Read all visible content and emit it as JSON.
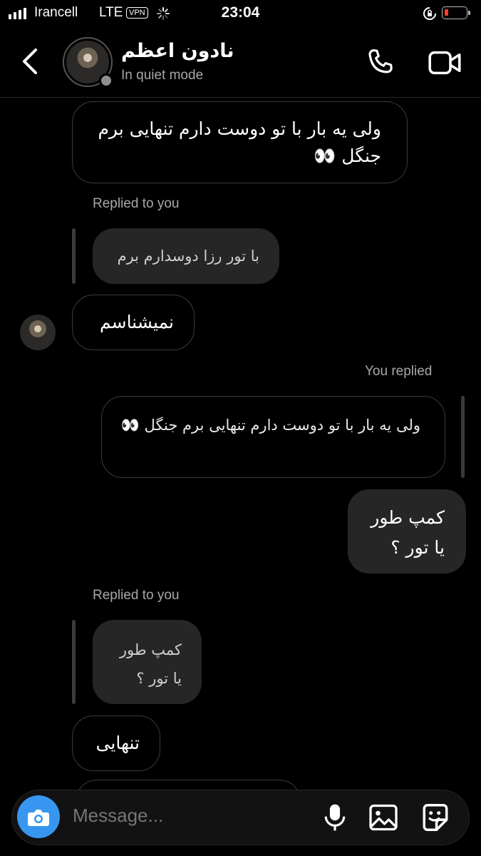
{
  "status_bar": {
    "carrier": "Irancell",
    "network": "LTE",
    "vpn": "VPN",
    "time": "23:04",
    "battery_level": 0.1
  },
  "header": {
    "name": "نادون اعظم",
    "status": "In quiet mode"
  },
  "messages": {
    "m1_text": "ولی یه بار با تو دوست دارم تنهایی برم جنگل 👀",
    "m2_meta": "Replied to you",
    "m2_quote": "با تور رزا دوسدارم برم",
    "m2_text": "نمیشناسم",
    "m3_meta": "You replied",
    "m3_quote": "ولی یه بار با تو دوست دارم تنهایی برم جنگل 👀",
    "m3_text": "کمپ طور یا تور ؟",
    "m4_meta": "Replied to you",
    "m4_quote": "کمپ طور یا تور ؟",
    "m4_text": "تنهایی"
  },
  "composer": {
    "placeholder": "Message..."
  },
  "icons": [
    "chevron-left-icon",
    "phone-icon",
    "video-camera-icon",
    "camera-icon",
    "microphone-icon",
    "gallery-icon",
    "sticker-icon"
  ]
}
